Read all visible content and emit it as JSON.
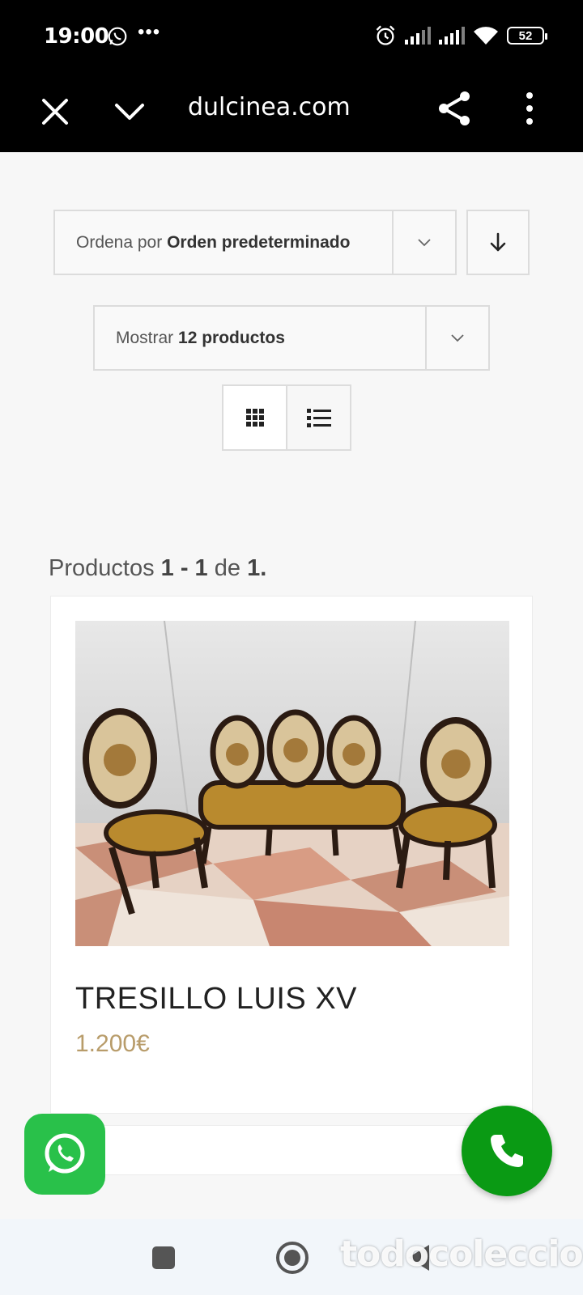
{
  "status_bar": {
    "time": "19:00",
    "battery": "52",
    "icons": [
      "whatsapp-icon",
      "more-dots-icon",
      "alarm-icon",
      "signal-icon",
      "signal-icon",
      "wifi-icon",
      "battery-icon"
    ]
  },
  "browser": {
    "url": "dulcinea.com",
    "icons": [
      "close-icon",
      "chevron-down-icon",
      "share-icon",
      "more-vertical-icon"
    ]
  },
  "sort": {
    "prefix": "Ordena por",
    "value": "Orden predeterminado"
  },
  "show": {
    "prefix": "Mostrar",
    "value": "12 productos"
  },
  "view_toggle": [
    "grid-icon",
    "list-icon"
  ],
  "results": {
    "prefix": "Productos",
    "range": "1 - 1",
    "of": "de",
    "total": "1."
  },
  "product": {
    "title": "TRESILLO LUIS XV",
    "price": "1.200€"
  },
  "watermark": "todocoleccion",
  "colors": {
    "whatsapp_green": "#29c14a",
    "call_green": "#0a9a14",
    "price": "#b89c6a"
  }
}
